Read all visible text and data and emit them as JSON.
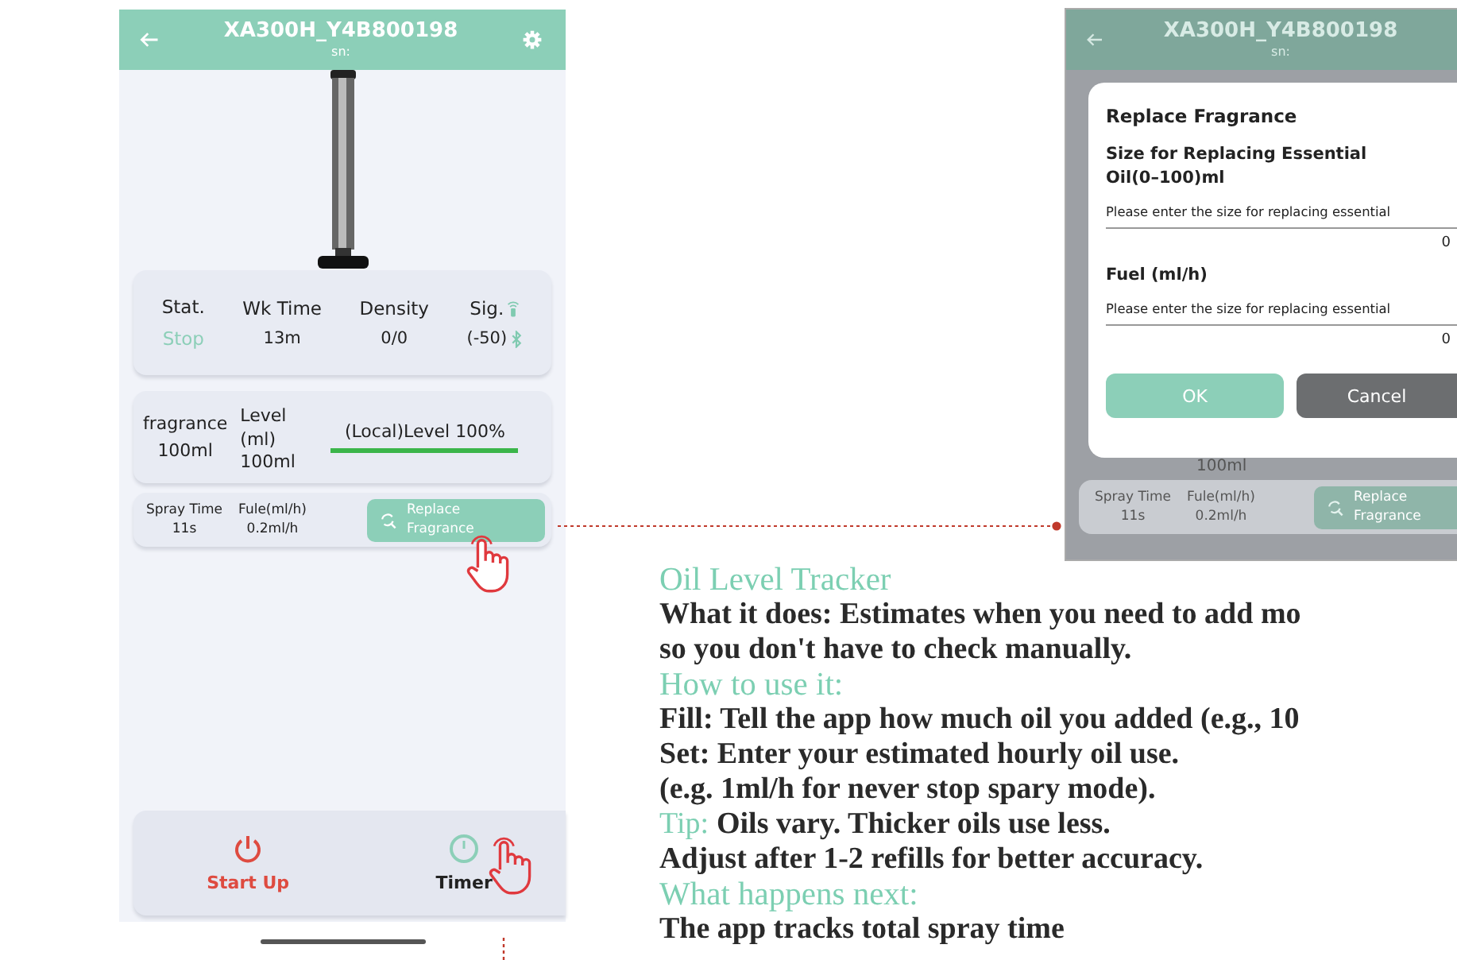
{
  "left_phone": {
    "header": {
      "title": "XA300H_Y4B800198",
      "subtitle": "sn:"
    },
    "stats": [
      {
        "kind": "status",
        "label": "Stat.",
        "value": "Stop"
      },
      {
        "kind": "plain",
        "label": "Wk Time",
        "value": "13m"
      },
      {
        "kind": "plain",
        "label": "Density",
        "value": "0/0"
      },
      {
        "kind": "signal",
        "label": "Sig.",
        "value": "(-50)"
      }
    ],
    "fragrance": {
      "label": "fragrance",
      "value": "100ml",
      "level_label": "Level\n(ml)",
      "level_value": "100ml",
      "meter_text": "(Local)Level 100%",
      "level": 1.0
    },
    "spray": [
      {
        "label": "Spray Time",
        "value": "11s"
      },
      {
        "label": "Fule(ml/h)",
        "value": "0.2ml/h"
      }
    ],
    "replace_button": "Replace Fragrance",
    "bottom_buttons": [
      {
        "kind": "power",
        "label": "Start Up"
      },
      {
        "kind": "timer",
        "label": "Timer"
      }
    ]
  },
  "right_phone": {
    "header": {
      "title": "XA300H_Y4B800198",
      "subtitle": "sn:"
    },
    "dialog": {
      "title": "Replace Fragrance",
      "fields": [
        {
          "label": "Size for Replacing Essential Oil(0–100)ml",
          "hint": "Please enter the size for replacing essential",
          "value": "0"
        },
        {
          "label": "Fuel (ml/h)",
          "hint": "Please enter the size for replacing essential",
          "value": "0"
        }
      ],
      "buttons": [
        {
          "kind": "confirm",
          "label": "OK"
        },
        {
          "kind": "cancel",
          "label": "Cancel"
        }
      ]
    },
    "behind_text": "100ml",
    "spray": [
      {
        "label": "Spray Time",
        "value": "11s"
      },
      {
        "label": "Fule(ml/h)",
        "value": "0.2ml/h"
      }
    ],
    "replace_button": "Replace Fragrance"
  },
  "description": [
    {
      "kind": "heading",
      "text": "Oil Level Tracker"
    },
    {
      "kind": "body",
      "text": "What it does: Estimates when you need to add mo"
    },
    {
      "kind": "body",
      "text": "so you don't have to check manually."
    },
    {
      "kind": "heading",
      "text": "How to use it:"
    },
    {
      "kind": "body",
      "text": "Fill: Tell the app how much oil you added (e.g., 10"
    },
    {
      "kind": "body",
      "text": "Set: Enter your estimated hourly oil use."
    },
    {
      "kind": "body",
      "text": "(e.g. 1ml/h for never stop spary mode)."
    },
    {
      "kind": "tip",
      "label": "Tip:",
      "text": "Oils vary. Thicker oils use less."
    },
    {
      "kind": "body",
      "text": "Adjust after 1-2 refills for better accuracy."
    },
    {
      "kind": "heading",
      "text": "What happens next:"
    },
    {
      "kind": "body",
      "text": "The app tracks total spray time"
    }
  ]
}
